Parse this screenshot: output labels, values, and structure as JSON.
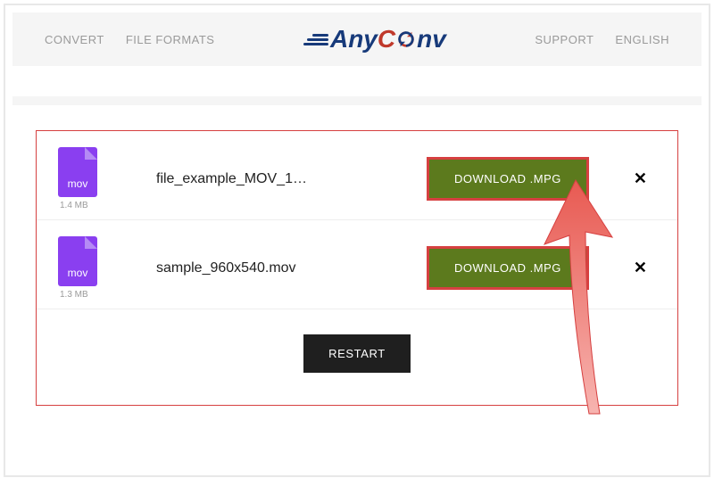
{
  "nav": {
    "left": [
      "CONVERT",
      "FILE FORMATS"
    ],
    "right": [
      "SUPPORT",
      "ENGLISH"
    ]
  },
  "logo": {
    "part1": "Any",
    "part2": "C",
    "part3": "nv"
  },
  "files": [
    {
      "ext": "mov",
      "name": "file_example_MOV_1…",
      "size": "1.4 MB",
      "download_label": "DOWNLOAD .MPG"
    },
    {
      "ext": "mov",
      "name": "sample_960x540.mov",
      "size": "1.3 MB",
      "download_label": "DOWNLOAD .MPG"
    }
  ],
  "restart_label": "RESTART",
  "colors": {
    "accent_red": "#d64040",
    "download_green": "#5c7a1d",
    "file_purple": "#8a3ff0",
    "logo_blue": "#173a7a",
    "logo_red": "#c0392b"
  }
}
